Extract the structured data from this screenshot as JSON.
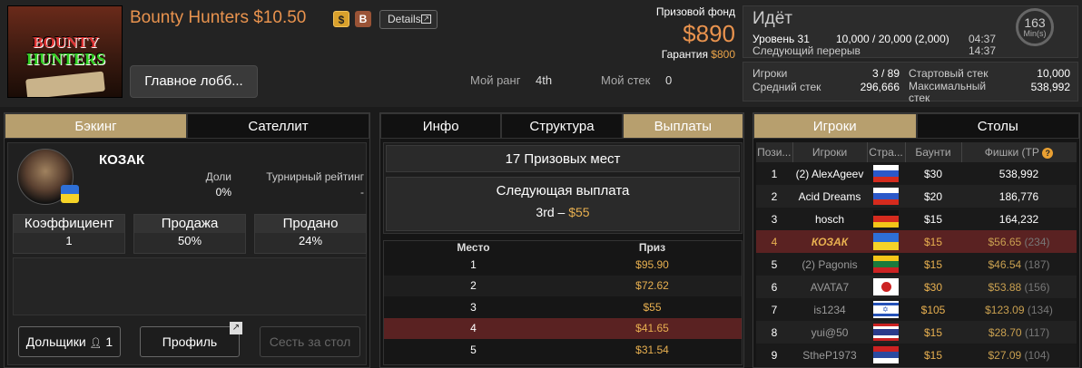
{
  "header": {
    "logo_line1": "BOUNTY",
    "logo_line2": "HUNTERS",
    "title": "Bounty Hunters $10.50",
    "badge_s": "$",
    "badge_b": "B",
    "details": "Details",
    "lobby_button": "Главное лобб...",
    "my_rank_label": "Мой ранг",
    "my_rank_value": "4th",
    "my_stack_label": "Мой стек",
    "my_stack_value": "0",
    "prize_pool_label": "Призовой фонд",
    "prize_pool_value": "$890",
    "guarantee_label": "Гарантия",
    "guarantee_value": "$800"
  },
  "status": {
    "state": "Идёт",
    "level": "Уровень 31",
    "blinds": "10,000 / 20,000 (2,000)",
    "time1": "04:37",
    "next_break": "Следующий перерыв",
    "time2": "14:37",
    "clock_value": "163",
    "clock_unit": "Min(s)"
  },
  "stats": {
    "players_label": "Игроки",
    "players_value": "3 / 89",
    "avg_stack_label": "Средний стек",
    "avg_stack_value": "296,666",
    "start_stack_label": "Стартовый стек",
    "start_stack_value": "10,000",
    "max_stack_label": "Максимальный стек",
    "max_stack_value": "538,992"
  },
  "left": {
    "tabs": [
      "Бэкинг",
      "Сателлит"
    ],
    "player_name": "КОЗАК",
    "shares_label": "Доли",
    "shares_value": "0%",
    "rating_label": "Турнирный рейтинг",
    "rating_value": "-",
    "boxes": [
      {
        "label": "Коэффициент",
        "value": "1"
      },
      {
        "label": "Продажа",
        "value": "50%"
      },
      {
        "label": "Продано",
        "value": "24%"
      }
    ],
    "shareholders_button": "Дольщики",
    "shareholders_count": "1",
    "profile_button": "Профиль",
    "sit_button": "Сесть за стол"
  },
  "mid": {
    "tabs": [
      "Инфо",
      "Структура",
      "Выплаты"
    ],
    "places": "17 Призовых мест",
    "next_payout_label": "Следующая выплата",
    "next_payout_place": "3rd",
    "next_payout_sep": "–",
    "next_payout_value": "$55",
    "col_place": "Место",
    "col_prize": "Приз",
    "rows": [
      {
        "place": "1",
        "prize": "$95.90"
      },
      {
        "place": "2",
        "prize": "$72.62"
      },
      {
        "place": "3",
        "prize": "$55"
      },
      {
        "place": "4",
        "prize": "$41.65"
      },
      {
        "place": "5",
        "prize": "$31.54"
      }
    ]
  },
  "right": {
    "tabs": [
      "Игроки",
      "Столы"
    ],
    "cols": [
      "Пози...",
      "Игроки",
      "Стра...",
      "Баунти",
      "Фишки (ТР"
    ],
    "help_icon": "?",
    "rows": [
      {
        "pos": "1",
        "name": "(2) AlexAgeev",
        "flag": "ru",
        "bounty": "$30",
        "chips": "538,992",
        "tp": ""
      },
      {
        "pos": "2",
        "name": "Acid Dreams",
        "flag": "ru",
        "bounty": "$20",
        "chips": "186,776",
        "tp": ""
      },
      {
        "pos": "3",
        "name": "hosch",
        "flag": "de",
        "bounty": "$15",
        "chips": "164,232",
        "tp": ""
      },
      {
        "pos": "4",
        "name": "КОЗАК",
        "flag": "ua",
        "bounty": "$15",
        "chips": "$56.65",
        "tp": "(234)"
      },
      {
        "pos": "5",
        "name": "(2) Pagonis",
        "flag": "lt",
        "bounty": "$15",
        "chips": "$46.54",
        "tp": "(187)"
      },
      {
        "pos": "6",
        "name": "AVATA7",
        "flag": "jp",
        "bounty": "$30",
        "chips": "$53.88",
        "tp": "(156)"
      },
      {
        "pos": "7",
        "name": "is1234",
        "flag": "il",
        "bounty": "$105",
        "chips": "$123.09",
        "tp": "(134)"
      },
      {
        "pos": "8",
        "name": "yui@50",
        "flag": "th",
        "bounty": "$15",
        "chips": "$28.70",
        "tp": "(117)"
      },
      {
        "pos": "9",
        "name": "StheP1973",
        "flag": "rs",
        "bounty": "$15",
        "chips": "$27.09",
        "tp": "(104)"
      }
    ]
  }
}
